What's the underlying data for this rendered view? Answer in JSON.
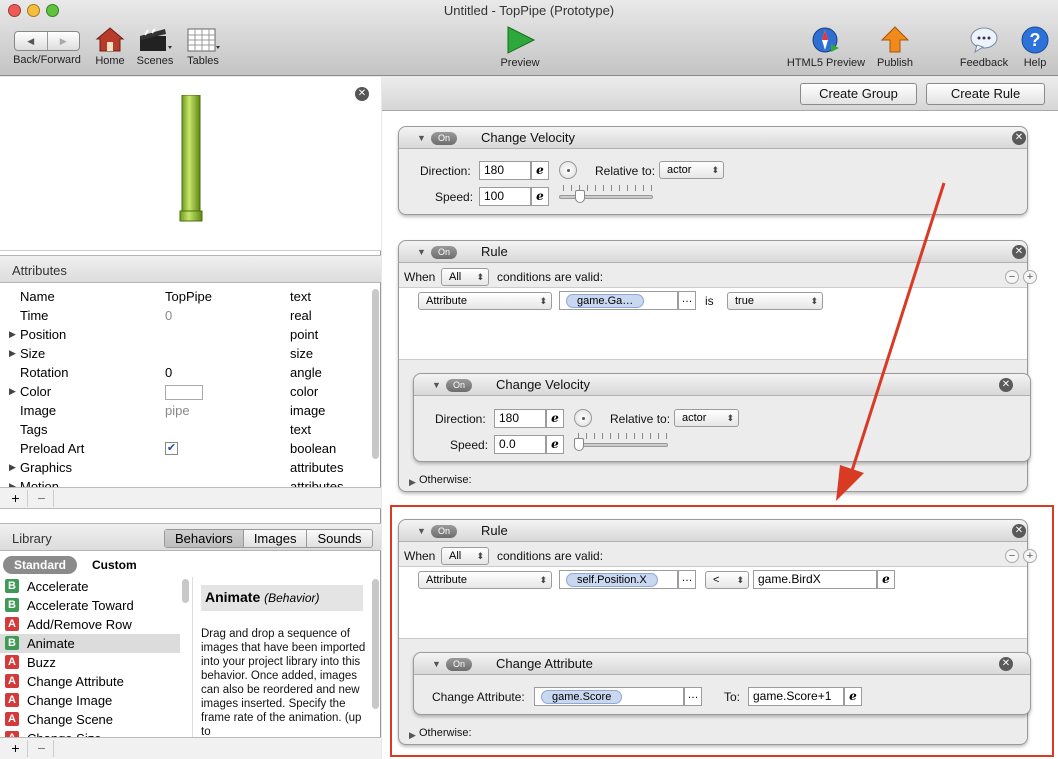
{
  "window": {
    "title": "Untitled - TopPipe (Prototype)"
  },
  "toolbar": {
    "back_forward": "Back/Forward",
    "home": "Home",
    "scenes": "Scenes",
    "tables": "Tables",
    "preview": "Preview",
    "html5_preview": "HTML5 Preview",
    "publish": "Publish",
    "feedback": "Feedback",
    "help": "Help"
  },
  "attributes": {
    "header": "Attributes",
    "rows": [
      {
        "name": "Name",
        "value": "TopPipe",
        "type": "text",
        "expandable": false
      },
      {
        "name": "Time",
        "value": "0",
        "type": "real",
        "expandable": false
      },
      {
        "name": "Position",
        "value": "",
        "type": "point",
        "expandable": true
      },
      {
        "name": "Size",
        "value": "",
        "type": "size",
        "expandable": true
      },
      {
        "name": "Rotation",
        "value": "0",
        "type": "angle",
        "expandable": false
      },
      {
        "name": "Color",
        "value": "",
        "type": "color",
        "expandable": true
      },
      {
        "name": "Image",
        "value": "pipe",
        "type": "image",
        "expandable": false
      },
      {
        "name": "Tags",
        "value": "",
        "type": "text",
        "expandable": false
      },
      {
        "name": "Preload Art",
        "value": "✔",
        "type": "boolean",
        "expandable": false
      },
      {
        "name": "Graphics",
        "value": "",
        "type": "attributes",
        "expandable": true
      },
      {
        "name": "Motion",
        "value": "",
        "type": "attributes",
        "expandable": true
      }
    ],
    "add": "+",
    "remove": "−"
  },
  "library": {
    "header": "Library",
    "tabs": [
      "Behaviors",
      "Images",
      "Sounds"
    ],
    "selected_tab": "Behaviors",
    "subtabs": [
      "Standard",
      "Custom"
    ],
    "items": [
      {
        "badge": "B",
        "label": "Accelerate"
      },
      {
        "badge": "B",
        "label": "Accelerate Toward"
      },
      {
        "badge": "A",
        "label": "Add/Remove Row"
      },
      {
        "badge": "B",
        "label": "Animate"
      },
      {
        "badge": "A",
        "label": "Buzz"
      },
      {
        "badge": "A",
        "label": "Change Attribute"
      },
      {
        "badge": "A",
        "label": "Change Image"
      },
      {
        "badge": "A",
        "label": "Change Scene"
      },
      {
        "badge": "A",
        "label": "Change Size"
      }
    ],
    "detail_title": "Animate",
    "detail_kind": "(Behavior)",
    "detail_text": "Drag and drop a sequence of images that have been imported into your project library into this behavior. Once added, images can also be reordered and new images inserted. Specify the frame rate of the animation. (up to"
  },
  "buttons": {
    "create_group": "Create Group",
    "create_rule": "Create Rule"
  },
  "behaviors": {
    "on": "On",
    "close": "✕",
    "cv1": {
      "title": "Change Velocity",
      "direction_label": "Direction:",
      "direction": "180",
      "speed_label": "Speed:",
      "speed": "100",
      "relative_label": "Relative to:",
      "relative": "actor"
    },
    "rule1": {
      "title": "Rule",
      "when": "When",
      "all": "All",
      "conditions": "conditions are valid:",
      "attr_popup": "Attribute",
      "token": "game.Ga…",
      "op": "is",
      "value": "true",
      "otherwise": "Otherwise:"
    },
    "cv2": {
      "title": "Change Velocity",
      "direction_label": "Direction:",
      "direction": "180",
      "speed_label": "Speed:",
      "speed": "0.0",
      "relative_label": "Relative to:",
      "relative": "actor"
    },
    "rule2": {
      "title": "Rule",
      "when": "When",
      "all": "All",
      "conditions": "conditions are valid:",
      "attr_popup": "Attribute",
      "token": "self.Position.X",
      "op": "<",
      "value": "game.BirdX",
      "otherwise": "Otherwise:"
    },
    "ca": {
      "title": "Change Attribute",
      "label": "Change Attribute:",
      "token": "game.Score",
      "to_label": "To:",
      "to": "game.Score+1"
    }
  },
  "colors": {
    "highlight": "#d83a24",
    "pipe_green": "#8fbf2e"
  }
}
